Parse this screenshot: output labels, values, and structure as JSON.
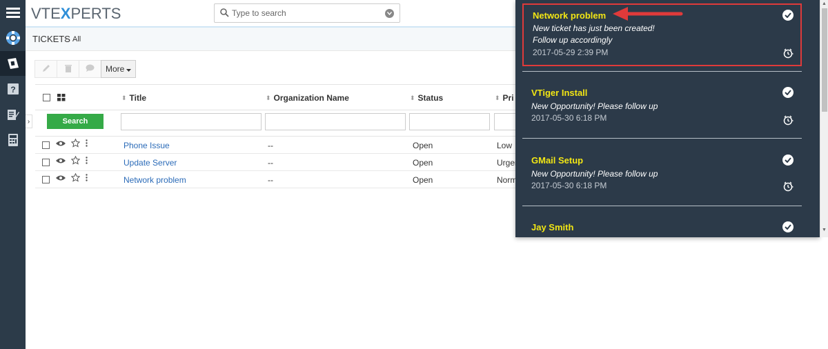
{
  "app": {
    "logo_prefix": "VTE",
    "logo_x": "X",
    "logo_suffix": "PERTS"
  },
  "search": {
    "placeholder": "Type to search"
  },
  "breadcrumb": {
    "module": "TICKETS",
    "separator": "›",
    "view": "All"
  },
  "toolbar": {
    "more_label": "More"
  },
  "table": {
    "headers": {
      "title": "Title",
      "organization": "Organization Name",
      "status": "Status",
      "priority": "Pri"
    },
    "search_button": "Search",
    "rows": [
      {
        "title": "Phone Issue",
        "organization": "--",
        "status": "Open",
        "priority": "Low"
      },
      {
        "title": "Update Server",
        "organization": "--",
        "status": "Open",
        "priority": "Urger"
      },
      {
        "title": "Network problem",
        "organization": "--",
        "status": "Open",
        "priority": "Norm"
      }
    ]
  },
  "notifications": [
    {
      "title": "Network problem",
      "message_line1": "New ticket has just been created!",
      "message_line2": "Follow up accordingly",
      "time": "2017-05-29 2:39 PM"
    },
    {
      "title": "VTiger Install",
      "message_line1": "New Opportunity! Please follow up",
      "message_line2": "",
      "time": "2017-05-30 6:18 PM"
    },
    {
      "title": "GMail Setup",
      "message_line1": "New Opportunity! Please follow up",
      "message_line2": "",
      "time": "2017-05-30 6:18 PM"
    },
    {
      "title": "Jay Smith",
      "message_line1": "",
      "message_line2": "",
      "time": ""
    }
  ],
  "colors": {
    "sidebar": "#2c3b49",
    "notif_bg": "#2c3a49",
    "notif_title": "#f2e614",
    "highlight": "#e03a3a",
    "search_button": "#35aa47",
    "link": "#2b6bb8"
  }
}
